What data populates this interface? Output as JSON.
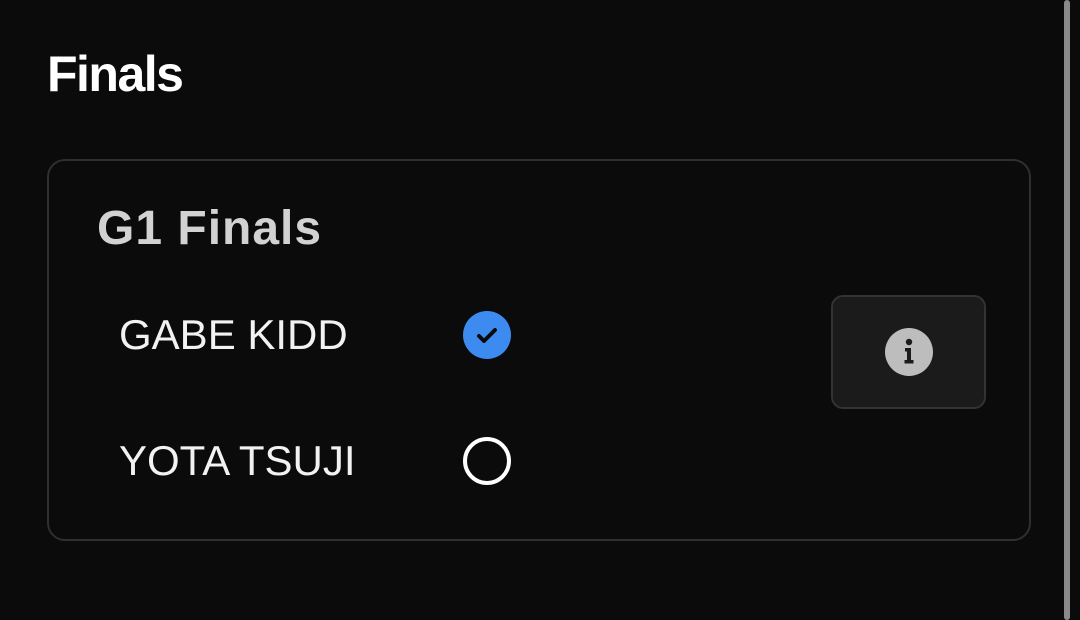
{
  "page": {
    "title": "Finals"
  },
  "card": {
    "title": "G1 Finals",
    "options": [
      {
        "label": "GABE KIDD",
        "selected": true
      },
      {
        "label": "YOTA TSUJI",
        "selected": false
      }
    ],
    "info_button": {
      "icon": "info-icon"
    }
  },
  "colors": {
    "background": "#0b0b0b",
    "accent": "#3d8bf0",
    "card_border": "#2f2f2f",
    "card_title": "#d2d2d2"
  }
}
